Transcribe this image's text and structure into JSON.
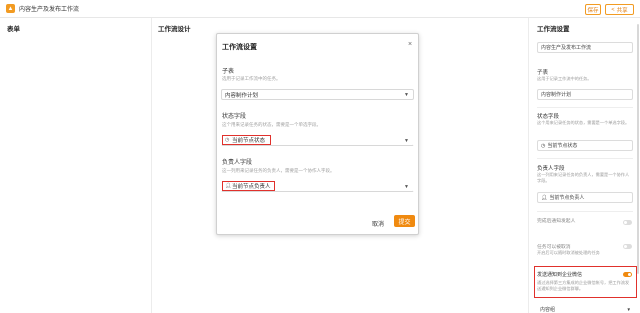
{
  "app": {
    "title": "内容生产及发布工作流",
    "buttons": {
      "save": "保存",
      "share": "共享"
    }
  },
  "panels": {
    "left_title": "表单",
    "mid_title": "工作流设计"
  },
  "modal": {
    "title": "工作流设置",
    "close_icon": "×",
    "subtable": {
      "label": "子表",
      "help": "选用于记录工作流中的任务。",
      "value": "内容制作计划"
    },
    "status_field": {
      "label": "状态字段",
      "help": "这个用来记录任务的状态，需要是一个单选字段。",
      "value": "当前节点状态"
    },
    "owner_field": {
      "label": "负责人字段",
      "help": "这一列用来记录任务的负责人，需要是一个协作人字段。",
      "value": "当前节点负责人"
    },
    "cancel": "取消",
    "submit": "提交"
  },
  "right_panel": {
    "title": "工作流设置",
    "workflow_name": "内容生产及发布工作流",
    "subtable": {
      "label": "子表",
      "help": "这用于记录工作流中的任务。",
      "value": "内容制作计划"
    },
    "status_field": {
      "label": "状态字段",
      "help": "这个用来记录任务的状态，需要是一个单选字段。",
      "value": "当前节点状态"
    },
    "owner_field": {
      "label": "负责人字段",
      "help": "这一列用来记录任务的负责人，需要是一个协作人字段。",
      "value": "当前节点负责人"
    },
    "notify_owner": {
      "label": "完成后通知发起人",
      "on": false
    },
    "allow_cancel": {
      "label": "任务可以被取消",
      "help": "开启后可以随时取消被处理的任务",
      "on": false
    },
    "wecom_notify": {
      "label": "发送通知到企业微信",
      "help": "通过选择第三方集成的企业微信帐号，把工作流发送通知到企业微信群聊。",
      "on": true
    },
    "wecom_select": "内容组"
  },
  "colors": {
    "accent": "#f08a10",
    "highlight_border": "#e0312c"
  }
}
